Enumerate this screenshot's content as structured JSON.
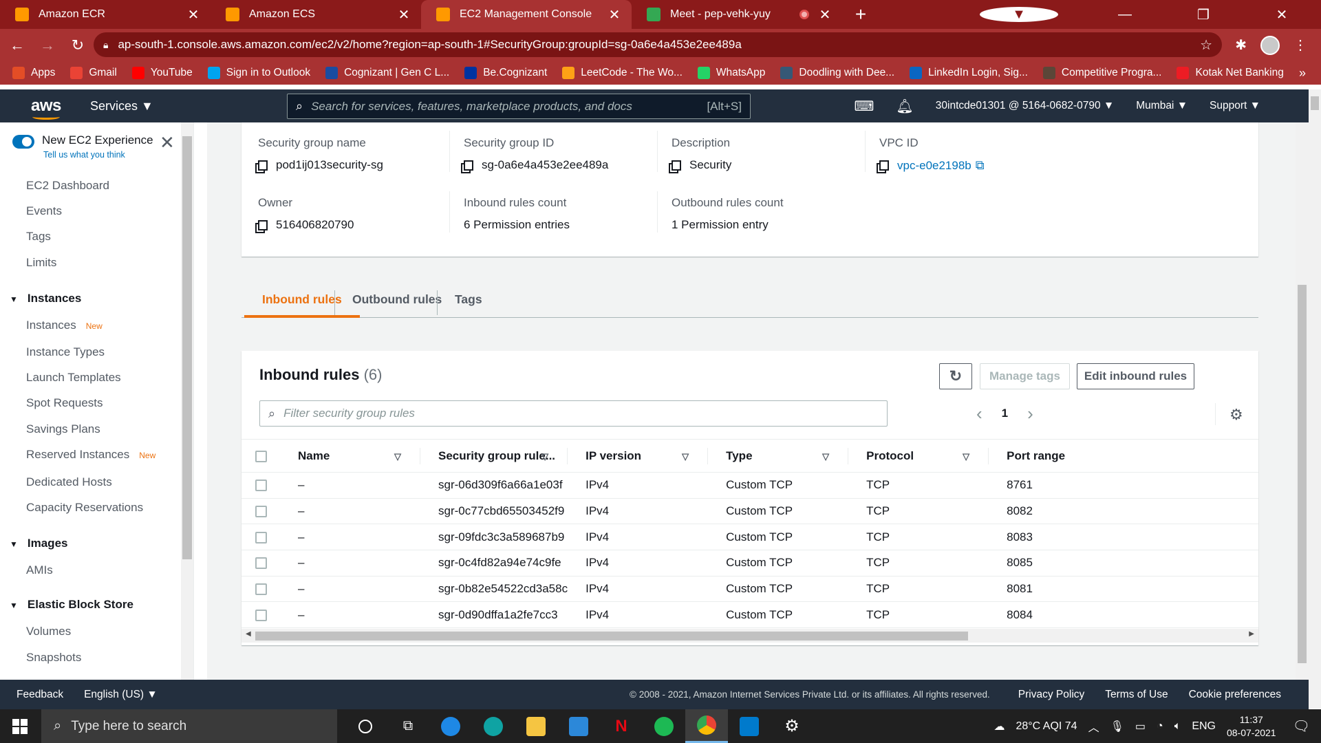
{
  "browser": {
    "tabs": [
      {
        "title": "Amazon ECR",
        "icon_color": "#ff9900",
        "active": false
      },
      {
        "title": "Amazon ECS",
        "icon_color": "#ff9900",
        "active": false
      },
      {
        "title": "EC2 Management Console",
        "icon_color": "#ff9900",
        "active": true
      },
      {
        "title": "Meet - pep-vehk-yuy",
        "icon_color": "#34a853",
        "active": false
      }
    ],
    "url": "ap-south-1.console.aws.amazon.com/ec2/v2/home?region=ap-south-1#SecurityGroup:groupId=sg-0a6e4a453e2ee489a",
    "bookmarks": [
      {
        "label": "Apps",
        "icon": "apps-icon",
        "color": "#e44d26"
      },
      {
        "label": "Gmail",
        "icon": "gmail-icon",
        "color": "#ea4335"
      },
      {
        "label": "YouTube",
        "icon": "youtube-icon",
        "color": "#ff0000"
      },
      {
        "label": "Sign in to Outlook",
        "icon": "microsoft-icon",
        "color": "#00a4ef"
      },
      {
        "label": "Cognizant | Gen C L...",
        "icon": "cognizant-icon",
        "color": "#1a4ca1"
      },
      {
        "label": "Be.Cognizant",
        "icon": "be-icon",
        "color": "#0033a0"
      },
      {
        "label": "LeetCode - The Wo...",
        "icon": "leetcode-icon",
        "color": "#ffa116"
      },
      {
        "label": "WhatsApp",
        "icon": "whatsapp-icon",
        "color": "#25d366"
      },
      {
        "label": "Doodling with Dee...",
        "icon": "tds-icon",
        "color": "#355876"
      },
      {
        "label": "LinkedIn Login, Sig...",
        "icon": "linkedin-icon",
        "color": "#0a66c2"
      },
      {
        "label": "Competitive Progra...",
        "icon": "cc-icon",
        "color": "#5b4638"
      },
      {
        "label": "Kotak Net Banking",
        "icon": "kotak-icon",
        "color": "#ed1c24"
      }
    ]
  },
  "aws_nav": {
    "logo": "aws",
    "services": "Services",
    "search_placeholder": "Search for services, features, marketplace products, and docs",
    "search_hint": "[Alt+S]",
    "account": "30intcde01301 @ 5164-0682-0790",
    "region": "Mumbai",
    "support": "Support"
  },
  "sidebar": {
    "experience_title": "New EC2 Experience",
    "experience_sub": "Tell us what you think",
    "items": [
      {
        "label": "EC2 Dashboard"
      },
      {
        "label": "Events"
      },
      {
        "label": "Tags"
      },
      {
        "label": "Limits"
      }
    ],
    "sections": [
      {
        "title": "Instances",
        "items": [
          "Instances",
          "Instance Types",
          "Launch Templates",
          "Spot Requests",
          "Savings Plans",
          "Reserved Instances",
          "Dedicated Hosts",
          "Capacity Reservations"
        ]
      },
      {
        "title": "Images",
        "items": [
          "AMIs"
        ]
      },
      {
        "title": "Elastic Block Store",
        "items": [
          "Volumes",
          "Snapshots"
        ]
      }
    ],
    "new_badge": "New"
  },
  "details": {
    "sg_name_label": "Security group name",
    "sg_name": "pod1ij013security-sg",
    "sg_id_label": "Security group ID",
    "sg_id": "sg-0a6e4a453e2ee489a",
    "desc_label": "Description",
    "desc": "Security",
    "vpc_label": "VPC ID",
    "vpc": "vpc-e0e2198b",
    "owner_label": "Owner",
    "owner": "516406820790",
    "inbound_count_label": "Inbound rules count",
    "inbound_count": "6 Permission entries",
    "outbound_count_label": "Outbound rules count",
    "outbound_count": "1 Permission entry"
  },
  "tabs": {
    "inbound": "Inbound rules",
    "outbound": "Outbound rules",
    "tags": "Tags"
  },
  "rules": {
    "title": "Inbound rules",
    "count": "(6)",
    "manage_tags": "Manage tags",
    "edit": "Edit inbound rules",
    "filter_placeholder": "Filter security group rules",
    "page": "1",
    "columns": [
      "Name",
      "Security group rule...",
      "IP version",
      "Type",
      "Protocol",
      "Port range"
    ],
    "rows": [
      {
        "name": "–",
        "rule": "sgr-06d309f6a66a1e03f",
        "ip": "IPv4",
        "type": "Custom TCP",
        "protocol": "TCP",
        "port": "8761"
      },
      {
        "name": "–",
        "rule": "sgr-0c77cbd65503452f9",
        "ip": "IPv4",
        "type": "Custom TCP",
        "protocol": "TCP",
        "port": "8082"
      },
      {
        "name": "–",
        "rule": "sgr-09fdc3c3a589687b9",
        "ip": "IPv4",
        "type": "Custom TCP",
        "protocol": "TCP",
        "port": "8083"
      },
      {
        "name": "–",
        "rule": "sgr-0c4fd82a94e74c9fe",
        "ip": "IPv4",
        "type": "Custom TCP",
        "protocol": "TCP",
        "port": "8085"
      },
      {
        "name": "–",
        "rule": "sgr-0b82e54522cd3a58c",
        "ip": "IPv4",
        "type": "Custom TCP",
        "protocol": "TCP",
        "port": "8081"
      },
      {
        "name": "–",
        "rule": "sgr-0d90dffa1a2fe7cc3",
        "ip": "IPv4",
        "type": "Custom TCP",
        "protocol": "TCP",
        "port": "8084"
      }
    ]
  },
  "footer": {
    "feedback": "Feedback",
    "language": "English (US)",
    "copyright": "© 2008 - 2021, Amazon Internet Services Private Ltd. or its affiliates. All rights reserved.",
    "privacy": "Privacy Policy",
    "terms": "Terms of Use",
    "cookies": "Cookie preferences"
  },
  "taskbar": {
    "search_placeholder": "Type here to search",
    "weather": "28°C AQI 74",
    "lang": "ENG",
    "time": "11:37",
    "date": "08-07-2021"
  }
}
